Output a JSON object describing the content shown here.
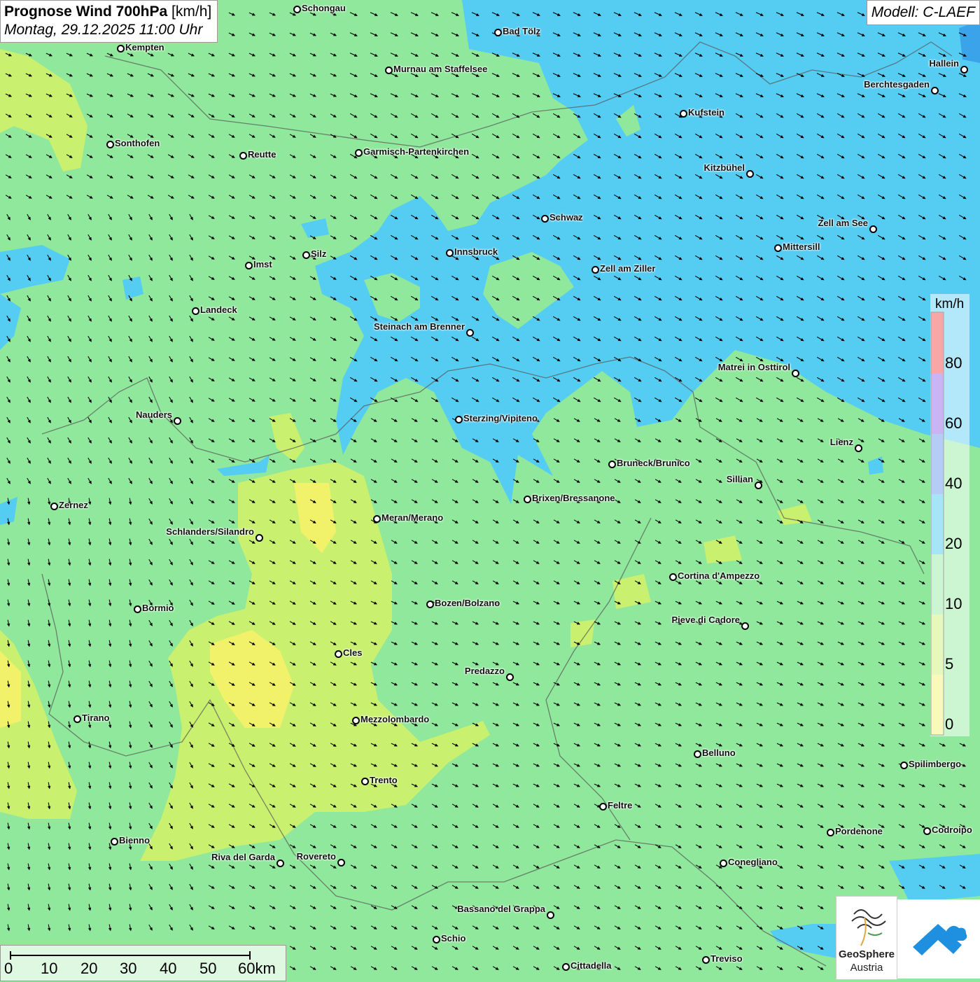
{
  "title": {
    "main_bold": "Prognose Wind 700hPa",
    "unit": "[km/h]",
    "datetime": "Montag, 29.12.2025 11:00 Uhr"
  },
  "model": "Modell: C-LAEF",
  "colors": {
    "yellow": "#f1f26a",
    "yellowgreen": "#c9f06e",
    "green": "#8fe89b",
    "cyan": "#55ccf2",
    "blue": "#3ba3ea",
    "purple": "#8c5ae6",
    "red": "#f23a3a"
  },
  "legend": {
    "unit": "km/h",
    "ticks": [
      "80",
      "60",
      "40",
      "20",
      "10",
      "5",
      "0"
    ]
  },
  "scale_bar": {
    "ticks": [
      "0",
      "10",
      "20",
      "30",
      "40",
      "50",
      "60km"
    ]
  },
  "logo": {
    "name_line1": "GeoSphere",
    "name_line2": "Austria"
  },
  "cities": [
    {
      "name": "Schongau"
    },
    {
      "name": "Kempten"
    },
    {
      "name": "Bad Tölz"
    },
    {
      "name": "Murnau am Staffelsee"
    },
    {
      "name": "Hallein"
    },
    {
      "name": "Berchtesgaden"
    },
    {
      "name": "Kufstein"
    },
    {
      "name": "Sonthofen"
    },
    {
      "name": "Reutte"
    },
    {
      "name": "Garmisch-Partenkirchen"
    },
    {
      "name": "Kitzbühel"
    },
    {
      "name": "Schwaz"
    },
    {
      "name": "Zell am See"
    },
    {
      "name": "Mittersill"
    },
    {
      "name": "Innsbruck"
    },
    {
      "name": "Silz"
    },
    {
      "name": "Imst"
    },
    {
      "name": "Zell am Ziller"
    },
    {
      "name": "Landeck"
    },
    {
      "name": "Steinach am Brenner"
    },
    {
      "name": "Matrei in Osttirol"
    },
    {
      "name": "Nauders"
    },
    {
      "name": "Sterzing/Vipiteno"
    },
    {
      "name": "Lienz"
    },
    {
      "name": "Bruneck/Brunico"
    },
    {
      "name": "Sillian"
    },
    {
      "name": "Zernez"
    },
    {
      "name": "Brixen/Bressanone"
    },
    {
      "name": "Meran/Merano"
    },
    {
      "name": "Schlanders/Silandro"
    },
    {
      "name": "Cortina d'Ampezzo"
    },
    {
      "name": "Bozen/Bolzano"
    },
    {
      "name": "Bormio"
    },
    {
      "name": "Pieve di Cadore"
    },
    {
      "name": "Cles"
    },
    {
      "name": "Predazzo"
    },
    {
      "name": "Tirano"
    },
    {
      "name": "Mezzolombardo"
    },
    {
      "name": "Belluno"
    },
    {
      "name": "Spilimbergo"
    },
    {
      "name": "Trento"
    },
    {
      "name": "Feltre"
    },
    {
      "name": "Pordenone"
    },
    {
      "name": "Codroipo"
    },
    {
      "name": "Bienno"
    },
    {
      "name": "Riva del Garda"
    },
    {
      "name": "Rovereto"
    },
    {
      "name": "Conegliano"
    },
    {
      "name": "Bassano del Grappa"
    },
    {
      "name": "Schio"
    },
    {
      "name": "Treviso"
    },
    {
      "name": "Cittadella"
    }
  ]
}
